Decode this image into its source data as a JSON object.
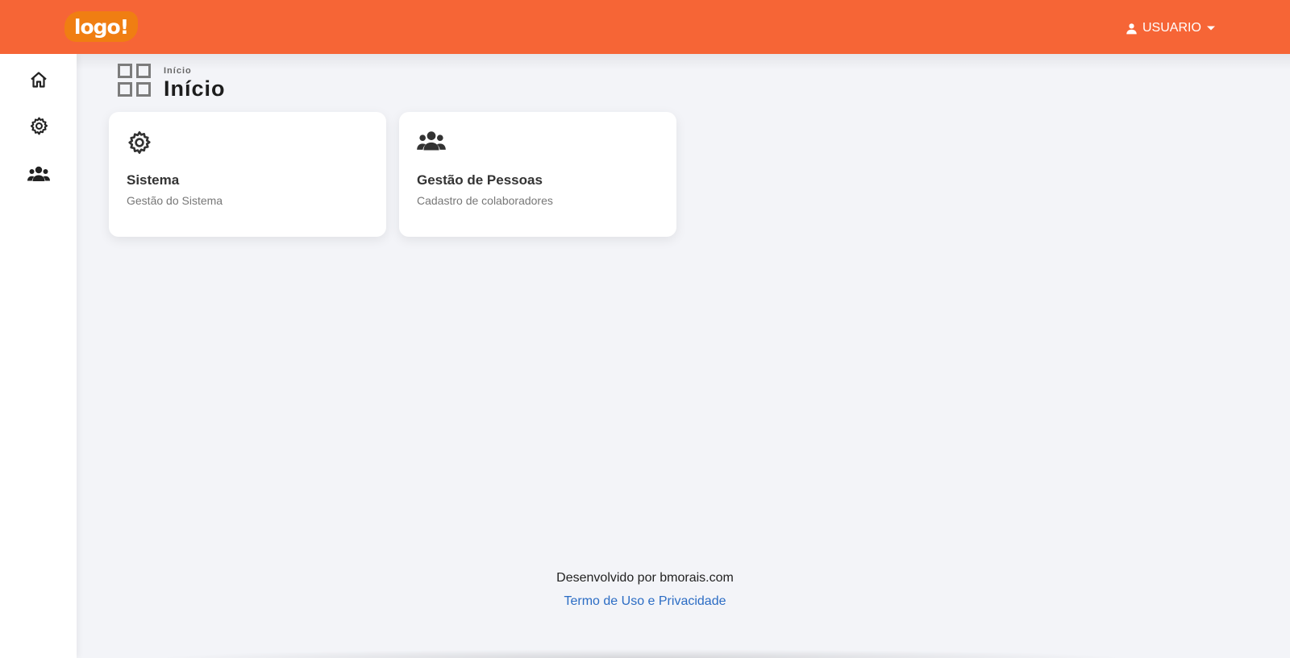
{
  "header": {
    "logo_text": "logo!",
    "user_label": "USUARIO",
    "accent_color": "#f66536",
    "logo_color": "#f07e12"
  },
  "sidebar": {
    "items": [
      {
        "icon": "home-icon"
      },
      {
        "icon": "gear-icon"
      },
      {
        "icon": "users-icon"
      }
    ]
  },
  "page": {
    "breadcrumb": "Início",
    "title": "Início",
    "icon": "grid-icon"
  },
  "cards": [
    {
      "icon": "gear-icon",
      "title": "Sistema",
      "subtitle": "Gestão do Sistema"
    },
    {
      "icon": "users-icon",
      "title": "Gestão de Pessoas",
      "subtitle": "Cadastro de colaboradores"
    }
  ],
  "footer": {
    "credit": "Desenvolvido por bmorais.com",
    "terms_link": "Termo de Uso e Privacidade",
    "link_color": "#2b6cc4"
  }
}
